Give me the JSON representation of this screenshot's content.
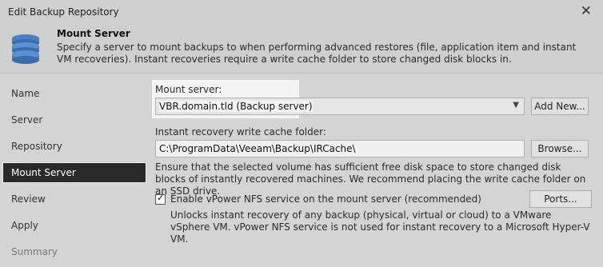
{
  "window": {
    "title": "Edit Backup Repository",
    "close_glyph": "✕"
  },
  "header": {
    "icon": "database-icon",
    "title": "Mount Server",
    "description": "Specify a server to mount backups to when performing advanced restores (file, application item and instant VM recoveries). Instant recoveries require a write cache folder to store changed disk blocks in."
  },
  "sidebar": {
    "items": [
      {
        "label": "Name"
      },
      {
        "label": "Server"
      },
      {
        "label": "Repository"
      },
      {
        "label": "Mount Server",
        "active": true
      },
      {
        "label": "Review"
      },
      {
        "label": "Apply"
      },
      {
        "label": "Summary"
      }
    ]
  },
  "main": {
    "mount_server_label": "Mount server:",
    "mount_server_value": "VBR.domain.tld (Backup server)",
    "add_new_label": "Add New...",
    "cache_folder_label": "Instant recovery write cache folder:",
    "cache_folder_value": "C:\\ProgramData\\Veeam\\Backup\\IRCache\\",
    "browse_label": "Browse...",
    "ssd_note": "Ensure that the selected volume has sufficient free disk space to store changed disk blocks of instantly recovered machines. We recommend placing the write cache folder on an SSD drive.",
    "nfs_checkbox_checked": true,
    "nfs_checkbox_label": "Enable vPower NFS service on the mount server (recommended)",
    "ports_label": "Ports...",
    "nfs_note": "Unlocks instant recovery of any backup (physical, virtual or cloud) to a VMware vSphere VM. vPower NFS service is not used for instant recovery to a Microsoft Hyper-V VM."
  }
}
